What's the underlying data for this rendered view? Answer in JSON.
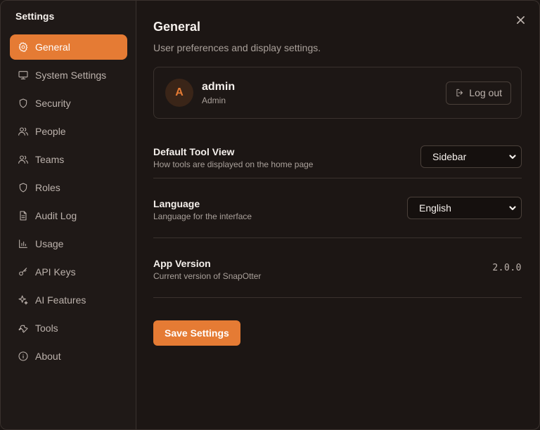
{
  "sidebar": {
    "title": "Settings",
    "items": [
      {
        "label": "General",
        "icon": "gear-icon",
        "active": true
      },
      {
        "label": "System Settings",
        "icon": "monitor-icon"
      },
      {
        "label": "Security",
        "icon": "shield-icon"
      },
      {
        "label": "People",
        "icon": "users-icon"
      },
      {
        "label": "Teams",
        "icon": "users-icon"
      },
      {
        "label": "Roles",
        "icon": "shield-icon"
      },
      {
        "label": "Audit Log",
        "icon": "document-icon"
      },
      {
        "label": "Usage",
        "icon": "bar-chart-icon"
      },
      {
        "label": "API Keys",
        "icon": "key-icon"
      },
      {
        "label": "AI Features",
        "icon": "sparkles-icon"
      },
      {
        "label": "Tools",
        "icon": "wrench-icon"
      },
      {
        "label": "About",
        "icon": "info-icon"
      }
    ]
  },
  "main": {
    "title": "General",
    "subtitle": "User preferences and display settings.",
    "user": {
      "avatar_letter": "A",
      "name": "admin",
      "role": "Admin",
      "logout_label": "Log out"
    },
    "settings": {
      "tool_view": {
        "label": "Default Tool View",
        "desc": "How tools are displayed on the home page",
        "value": "Sidebar"
      },
      "language": {
        "label": "Language",
        "desc": "Language for the interface",
        "value": "English"
      },
      "version": {
        "label": "App Version",
        "desc": "Current version of SnapOtter",
        "value": "2.0.0"
      }
    },
    "save_label": "Save Settings"
  },
  "colors": {
    "accent": "#e57b34",
    "background": "#1c1614",
    "border": "#3a322e"
  }
}
